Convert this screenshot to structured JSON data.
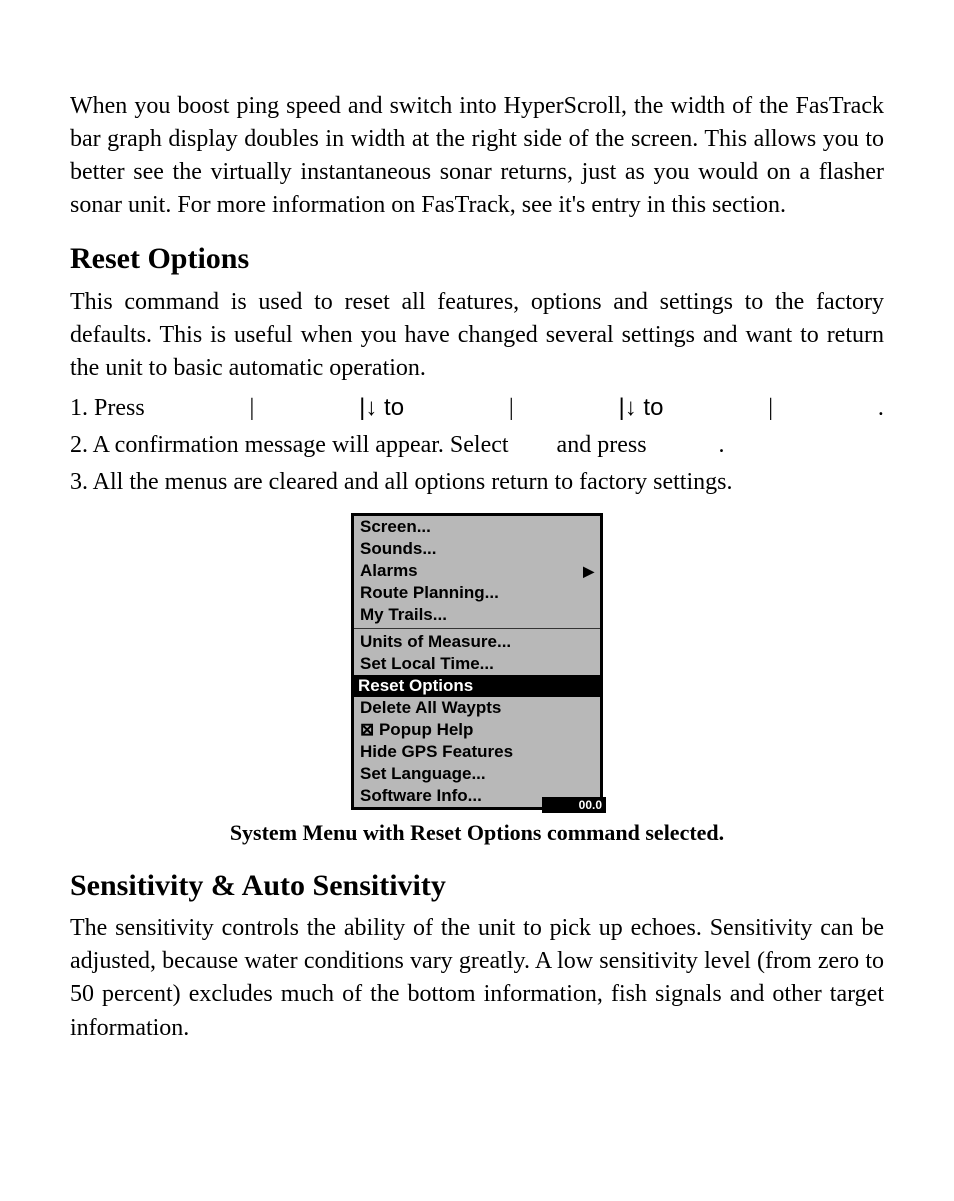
{
  "intro_paragraph": "When you boost ping speed and switch into HyperScroll, the width of the FasTrack bar graph display doubles in width at the right side of the screen. This allows you to better see the virtually instantaneous sonar returns, just as you would on a flasher sonar unit. For more information on FasTrack, see it's entry in this section.",
  "section_reset": {
    "heading": "Reset Options",
    "paragraph": "This command is used to reset all features, options and settings to the factory defaults. This is useful when you have changed several settings and want to return the unit to basic automatic operation.",
    "step1": {
      "lead": "1. Press",
      "bar1": "|",
      "mid1": "|↓ to",
      "bar2": "|",
      "mid2": "|↓ to",
      "bar3": "|",
      "period": "."
    },
    "step2": "2. A confirmation message will appear. Select        and press            .",
    "step3": "3. All the menus are cleared and all options return to factory settings."
  },
  "menu": {
    "items_top": [
      "Screen...",
      "Sounds...",
      "Alarms",
      "Route Planning...",
      "My Trails..."
    ],
    "alarms_has_submenu": "▶",
    "items_mid": [
      "Units of Measure...",
      "Set Local Time..."
    ],
    "selected": "Reset Options",
    "items_bottom": [
      "Delete All Waypts",
      "⊠ Popup Help",
      "Hide GPS Features",
      "Set Language...",
      "Software Info..."
    ],
    "overlay": "00.0"
  },
  "caption": "System Menu with Reset Options command selected.",
  "section_sensitivity": {
    "heading": "Sensitivity & Auto Sensitivity",
    "paragraph": "The sensitivity controls the ability of the unit to pick up echoes. Sensitivity can be adjusted, because water conditions vary greatly. A low sensitivity level (from zero to 50 percent) excludes much of the bottom information, fish signals and other target information."
  }
}
